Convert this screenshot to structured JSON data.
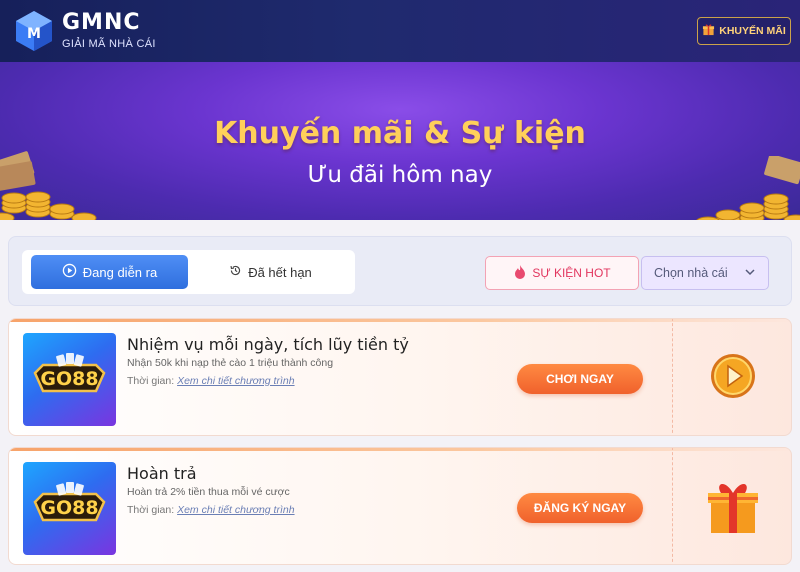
{
  "header": {
    "brand": "GMNC",
    "tagline": "GIẢI MÃ NHÀ CÁI",
    "promo_button": "KHUYẾN MÃI"
  },
  "banner": {
    "title": "Khuyến mãi & Sự kiện",
    "subtitle": "Ưu đãi hôm nay"
  },
  "filters": {
    "tabs": [
      {
        "label": "Đang diễn ra",
        "icon": "play-circle-icon",
        "active": true
      },
      {
        "label": "Đã hết hạn",
        "icon": "history-icon",
        "active": false
      }
    ],
    "hot_label": "SỰ KIỆN HOT",
    "select_value": "Chọn nhà cái"
  },
  "promotions": [
    {
      "brand_logo": "GO88",
      "title": "Nhiệm vụ mỗi ngày, tích lũy tiền tỷ",
      "description": "Nhận 50k khi nạp thẻ cào 1 triệu thành công",
      "time_label": "Thời gian:",
      "time_link": "Xem chi tiết chương trình",
      "button": "CHƠI NGAY",
      "side_icon": "play-coin-icon"
    },
    {
      "brand_logo": "GO88",
      "title": "Hoàn trả",
      "description": "Hoàn trả 2% tiền thua mỗi vé cược",
      "time_label": "Thời gian:",
      "time_link": "Xem chi tiết chương trình",
      "button": "ĐĂNG KÝ NGAY",
      "side_icon": "gift-box-icon"
    }
  ],
  "colors": {
    "header_bg": "#1f2a6e",
    "banner_bg": "#6b35d0",
    "title_gold": "#ffd05a",
    "tab_active": "#2f6fde",
    "cta_orange": "#f0612c",
    "hot_pink": "#e2365f"
  }
}
